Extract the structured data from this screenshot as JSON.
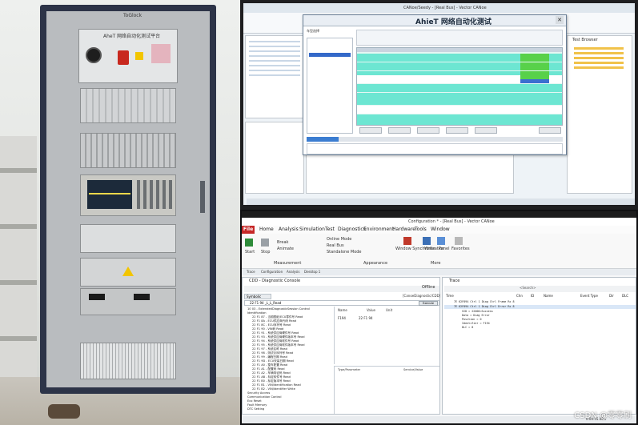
{
  "photo": {
    "cabinet_brand": "ToGlock",
    "panel_title": "AheT 网络自动化测试平台"
  },
  "top_screen": {
    "window_title": "CANoe/Seedy - [Real Bus] - Vector CANoe",
    "dialog": {
      "title": "AhieT 网络自动化测试",
      "tree_label": "车型选择",
      "rows": 17
    },
    "right_tab": "Test Browser"
  },
  "bottom_screen": {
    "window_title": "Configuration * - [Real Bus] - Vector CANoe",
    "ribbon_tabs": [
      "Home",
      "Analysis",
      "Simulation",
      "Test",
      "Diagnostics",
      "Environment",
      "Hardware",
      "Tools",
      "Window"
    ],
    "file_tab": "File",
    "ribbon_buttons": {
      "start": "Start",
      "stop": "Stop",
      "break": "Break",
      "animate": "Animate",
      "online_mode": "Online Mode",
      "real_bus": "Real Bus",
      "standalone": "Standalone Mode",
      "window_sync": "Window Synchronization",
      "write": "Write",
      "panel": "Panel",
      "favorites": "Favorites"
    },
    "ribbon_groups": [
      "Measurement",
      "Appearance",
      "More"
    ],
    "doc_tabs": [
      "Trace",
      "Configuration",
      "Analysis",
      "Desktop 1"
    ],
    "cdd": {
      "title": "CDD - Diagnostic Console",
      "offline": "Offline",
      "symbols": "Symbolic",
      "ecu": "[CanoeDiagnostic/CDD]",
      "request": "22 F1 94  _L_L_Read",
      "execute": "Execute",
      "tree": [
        "10 03 - ExtendedDiagnosticSession Control",
        "Identification",
        "22 F1 87 - 当前图纸/ECU零件号 Read",
        "22 F1 8A - ECU供应商代码 Read",
        "22 F1 8C - ECU序列号 Read",
        "22 F1 90 - VIN码 Read",
        "22 F1 91 - 系统供应商硬件号 Read",
        "22 F1 93 - 系统供应商硬件版本号 Read",
        "22 F1 94 - 系统供应商软件号 Read",
        "22 F1 95 - 系统供应商软件版本号 Read",
        "22 F1 97 - 系统名称 Read",
        "22 F1 98 - 测试仪序列号 Read",
        "22 F1 99 - 编程日期 Read",
        "22 F1 9D - ECU安装日期 Read",
        "22 F1 A0 - 整车配置 Read",
        "22 F1 A1 - 配置码 Read",
        "22 F1 A2 - 车辆特征码 Read",
        "22 F1 AB - 标定软件号 Read",
        "22 F1 B0 - 标定版本号 Read",
        "22 F1 B1 - VIN/Identification Read",
        "22 F1 B2 - VIN/Identifier Write",
        "Security Access",
        "Communication Control",
        "Eco Reset",
        "Fault Memory",
        "DTC Setting"
      ],
      "value_headers": [
        "Name",
        "Value",
        "Unit"
      ],
      "value_name": "F194",
      "value_value": "22 F1 94",
      "param_headers": [
        "Type/Parameter",
        "Service/Value"
      ]
    },
    "trace": {
      "title": "Trace",
      "search": "<Search>",
      "headers": [
        "Time",
        "Chn",
        "ID",
        "Name",
        "Event Type",
        "Dir",
        "DLC"
      ],
      "lines": [
        "7E 62F094    Ctrl 1  Diag         Ctrl Frame     Rx   8",
        "7E 62F094    Ctrl 1  Diag         Ctrl Error     Rx   8",
        "  SID         =  22000=Success",
        "  Data        =  Diag Error",
        "  Position    =  0",
        "  Identifier  =  F194",
        "  DLC         =  8"
      ]
    },
    "status_time": "0:00:55.00 s"
  },
  "watermark": "CSDN @零零刷"
}
